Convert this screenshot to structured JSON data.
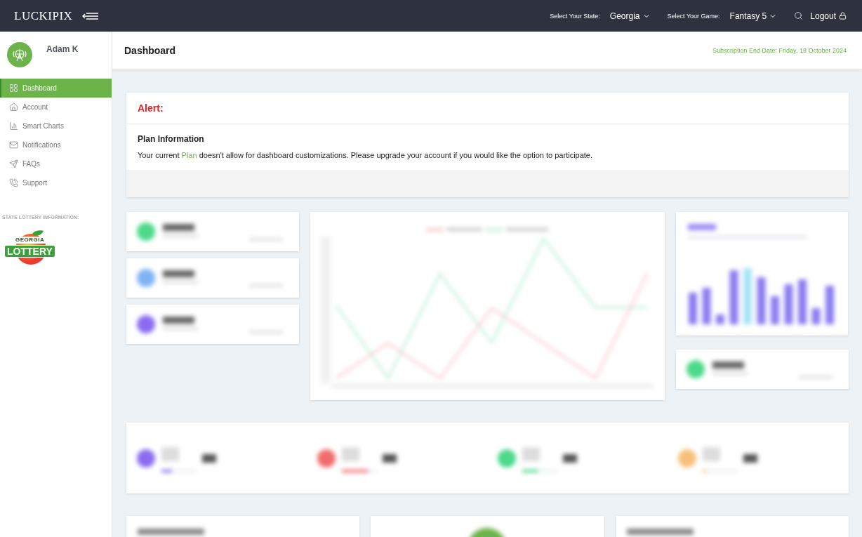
{
  "topbar": {
    "logo": "LUCKIPIX",
    "state_label": "Select Your State:",
    "state": "Georgia",
    "game_label": "Select Your Game:",
    "game": "Fantasy 5",
    "logout": "Logout"
  },
  "user": {
    "name": "Adam K"
  },
  "sidebar": {
    "items": [
      {
        "label": "Dashboard",
        "selected": true
      },
      {
        "label": "Account",
        "selected": false
      },
      {
        "label": "Smart Charts",
        "selected": false
      },
      {
        "label": "Notifications",
        "selected": false
      },
      {
        "label": "FAQs",
        "selected": false
      },
      {
        "label": "Support",
        "selected": false
      }
    ],
    "section_label": "STATE LOTTERY INFORMATION:",
    "lottery_logo": {
      "top": "GEORGIA",
      "main": "LOTTERY"
    }
  },
  "summary": {
    "items": [
      {
        "color": "#8b6cf0",
        "level": 0.3
      },
      {
        "color": "#f06c6c",
        "level": 0.75
      },
      {
        "color": "#4cd98a",
        "level": 0.45
      },
      {
        "color": "#f7c07a",
        "level": 0.1
      }
    ]
  },
  "header": {
    "title": "Dashboard",
    "subscription": "Subscription End Date: Friday, 18 October 2024"
  },
  "alert": {
    "title": "Alert:",
    "section_title": "Plan Information",
    "message": {
      "before": "Your current ",
      "link": "Plan",
      "after": " doesn't allow for dashboard customizations. Please upgrade your account if you would like the option to participate."
    }
  }
}
